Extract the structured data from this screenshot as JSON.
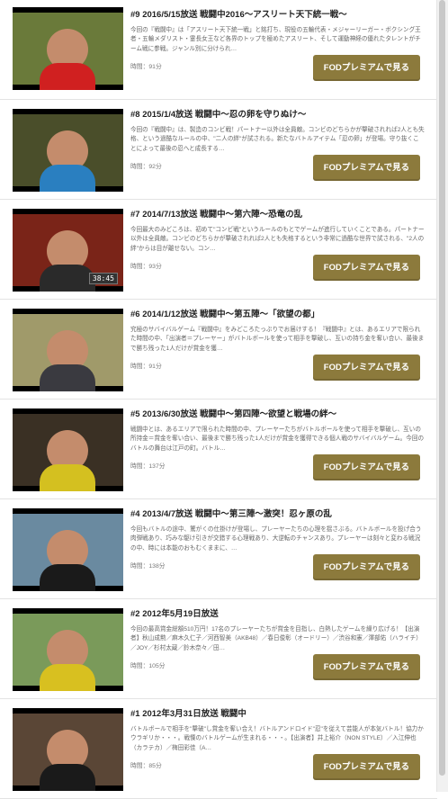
{
  "episodes": [
    {
      "title": "#9 2016/5/15放送 戦闘中2016〜アスリート天下統一戦〜",
      "description": "今回の『戦闘中』は「アスリート天下統一戦」と銘打ち、現役の五輪代表・メジャーリーガー・ボクシング王者・五輪メダリスト・霊長女王など各界のトップを極めたアスリート、そして運動神経の優れたタレントがチーム戦に参戦。ジャンル別に分けられ…",
      "duration": "時間：91分",
      "button_label": "FODプレミアムで見る"
    },
    {
      "title": "#8 2015/1/4放送 戦闘中〜忍の卵を守りぬけ〜",
      "description": "今回の『戦闘中』は、製造のコンビ戦！パートナー以外は全員敵。コンビのどちらかが撃破されれば2人とも失格、という過酷なルールの中、\"二人の絆\"が試される。新たなバトルアイテム「忍の卵」が登場。守り抜くことによって最後の忍へと成長する…",
      "duration": "時間：92分",
      "button_label": "FODプレミアムで見る"
    },
    {
      "title": "#7 2014/7/13放送 戦闘中〜第六陣〜恐竜の乱",
      "description": "今回最大のみどころは、初めて\"コンビ戦\"というルールのもとでゲームが進行していくことである。パートナー以外は全員敵。コンビのどちらかが撃破されれば2人とも失格するという非常に過酷な世界で試される、\"2人の絆\"からは目が離せない。コン…",
      "duration": "時間：93分",
      "button_label": "FODプレミアムで見る"
    },
    {
      "title": "#6 2014/1/12放送 戦闘中〜第五陣〜「欲望の都」",
      "description": "究極のサバイバルゲーム『戦闘中』をみどころたっぷりでお届けする！『戦闘中』とは、あるエリアで限られた時間の中、「出演者＝プレーヤー」がバトルボールを使って相手を撃破し、互いの持ち金を奪い合い、最後まで勝ち残った1人だけが賞金を獲…",
      "duration": "時間：91分",
      "button_label": "FODプレミアムで見る"
    },
    {
      "title": "#5 2013/6/30放送 戦闘中〜第四陣〜欲望と戦場の絆〜",
      "description": "戦闘中とは、あるエリアで限られた時間の中、プレーヤーたちがバトルボールを使って相手を撃破し、互いの所持金＝賞金を奪い合い、最後まで勝ち残った1人だけが賞金を獲得できる個人戦のサバイバルゲーム。今回のバトルの舞台は江戸の町。バトル…",
      "duration": "時間：137分",
      "button_label": "FODプレミアムで見る"
    },
    {
      "title": "#4 2013/4/7放送 戦闘中〜第三陣〜激突！忍ヶ原の乱",
      "description": "今回もバトルの途中、驚がくの仕掛けが登場し、プレーヤーたちの心理を揺さぶる。バトルボールを投げ合う肉弾戦あり、巧みな駆け引きが交錯する心理戦あり、大逆転のチャンスあり。プレーヤーは刻々と変わる戦況の中、時には本能のおもむくままに、…",
      "duration": "時間：138分",
      "button_label": "FODプレミアムで見る"
    },
    {
      "title": "#2 2012年5月19日放送",
      "description": "今回の最高賞金総額510万円！17名のプレーヤーたちが賞金を目指し、白熱したゲームを繰り広げる！【出演者】秋山成勲／麻木久仁子／河西智美（AKB48）／春日俊彰（オードリー）／渋谷和憲／澤部佑（ハライチ）／JOY／杉村太蔵／鈴木奈々／田…",
      "duration": "時間：105分",
      "button_label": "FODプレミアムで見る"
    },
    {
      "title": "#1 2012年3月31日放送 戦闘中",
      "description": "バトルボールで相手を\"撃破\"し賞金を奪い合え！バトルアンドロイド\"忍\"を従えて芸能人が本気バトル！協力かウラギリか・・・。戦慄のバトルゲームが生まれる・・・。【出演者】井上裕介（NON STYLE）／入江伸也（カラテカ）／梅田彩佳（A…",
      "duration": "時間：85分",
      "button_label": "FODプレミアムで見る"
    }
  ],
  "thumbnails": [
    {
      "icon": "athlete-headband-thumbnail",
      "bg": "#6a7a3a",
      "body": "#d02020"
    },
    {
      "icon": "player-vest-thumbnail",
      "bg": "#4a4e2a",
      "body": "#2a7fc0"
    },
    {
      "icon": "player-red-gate-thumbnail",
      "bg": "#7a2418",
      "body": "#2a2a2a"
    },
    {
      "icon": "player-forest-thumbnail",
      "bg": "#a09a6a",
      "body": "#3a3a40"
    },
    {
      "icon": "two-players-thumbnail",
      "bg": "#3a3024",
      "body": "#d4c020"
    },
    {
      "icon": "player-helmet-thumbnail",
      "bg": "#6a8aa0",
      "body": "#1a1a1a"
    },
    {
      "icon": "player-shouting-thumbnail",
      "bg": "#7a9a5a",
      "body": "#d8c020"
    },
    {
      "icon": "ninja-android-thumbnail",
      "bg": "#5a4636",
      "body": "#1a1a1a"
    }
  ],
  "counter_text": "38:45"
}
